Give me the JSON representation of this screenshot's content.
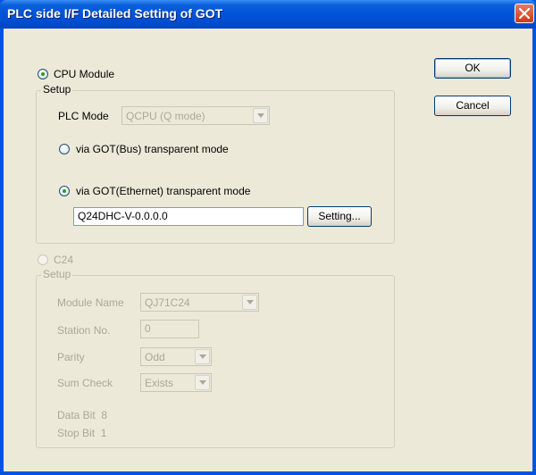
{
  "window": {
    "title": "PLC side I/F Detailed Setting of GOT"
  },
  "buttons": {
    "ok": "OK",
    "cancel": "Cancel",
    "setting": "Setting..."
  },
  "cpu": {
    "radio_label": "CPU Module",
    "group_label": "Setup",
    "plc_mode_label": "PLC Mode",
    "plc_mode_value": "QCPU (Q mode)",
    "bus_mode_label": "via GOT(Bus) transparent mode",
    "ethernet_mode_label": "via GOT(Ethernet) transparent mode",
    "ethernet_value": "Q24DHC-V-0.0.0.0"
  },
  "c24": {
    "radio_label": "C24",
    "group_label": "Setup",
    "module_name_label": "Module Name",
    "module_name_value": "QJ71C24",
    "station_label": "Station No.",
    "station_value": "0",
    "parity_label": "Parity",
    "parity_value": "Odd",
    "sum_check_label": "Sum Check",
    "sum_check_value": "Exists",
    "data_bit_text": "Data Bit  8",
    "stop_bit_text": "Stop Bit  1"
  },
  "colors": {
    "title_bar": "#0054e3",
    "dialog_face": "#ece9d8",
    "disabled_text": "#aca899",
    "close_button": "#c93b1c"
  },
  "icons": {
    "close": "close-icon",
    "dropdown": "chevron-down-icon"
  }
}
